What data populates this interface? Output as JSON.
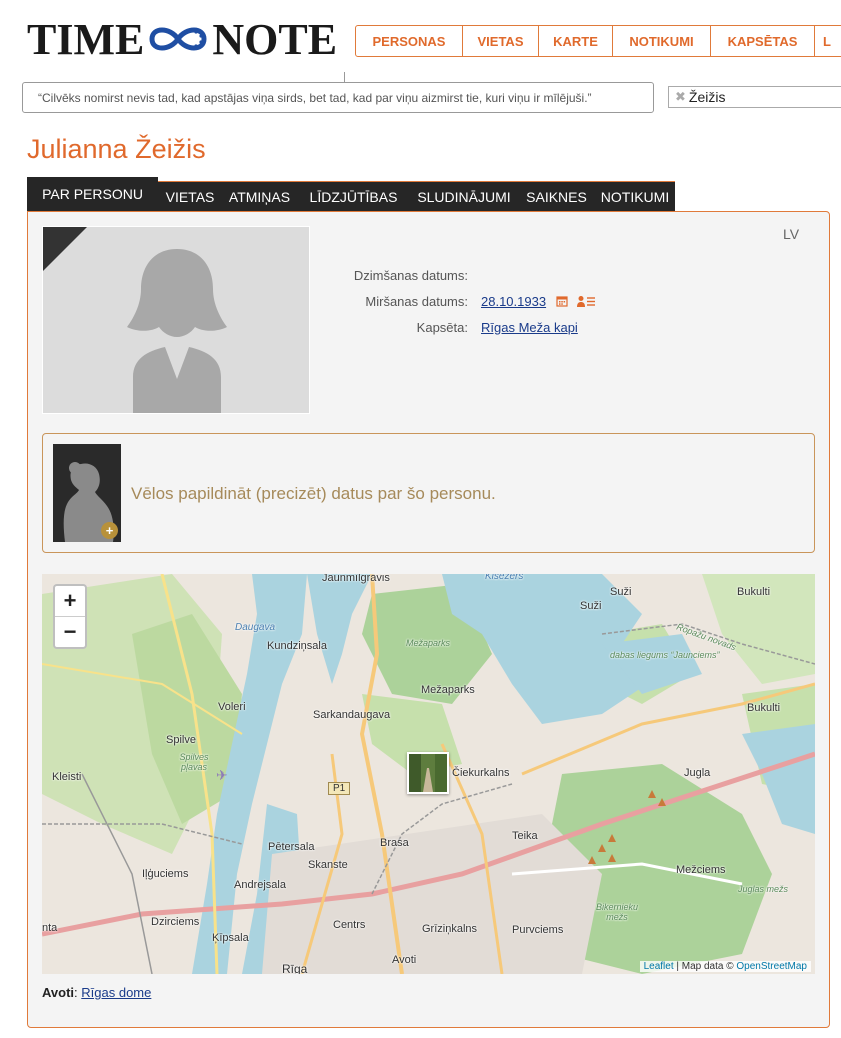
{
  "logo": {
    "left": "TIME",
    "right": "NOTE"
  },
  "topnav": [
    "PERSONAS",
    "VIETAS",
    "KARTE",
    "NOTIKUMI",
    "KAPSĒTAS",
    "L"
  ],
  "quote": "“Cilvēks nomirst nevis tad, kad apstājas viņa sirds, bet tad, kad par viņu aizmirst tie, kuri viņu ir mīlējuši.”",
  "search": {
    "value": "Žeižis"
  },
  "person": {
    "name": "Julianna Žeižis"
  },
  "tabs": [
    "PAR PERSONU",
    "VIETAS",
    "ATMIŅAS",
    "LĪDZJŪTĪBAS",
    "SLUDINĀJUMI",
    "SAIKNES",
    "NOTIKUMI"
  ],
  "lang": "LV",
  "info": {
    "birth_label": "Dzimšanas datums:",
    "birth_value": "",
    "death_label": "Miršanas datums:",
    "death_value": "28.10.1933",
    "cemetery_label": "Kapsēta:",
    "cemetery_value": "Rīgas Meža kapi"
  },
  "suggest": {
    "text": "Vēlos papildināt (precizēt) datus par šo personu.",
    "plus": "+"
  },
  "map": {
    "zoom_in": "+",
    "zoom_out": "−",
    "labels": [
      "Jaunmīlgrāvis",
      "Kīšezers",
      "Suži",
      "Suži",
      "Bukulti",
      "Mežaparks",
      "Kundziņsala",
      "Daugava",
      "Mežaparks",
      "Ropažu novads",
      "dabas liegums “Jaunciems”",
      "Voleri",
      "Sarkandaugava",
      "Bukulti",
      "Spilve",
      "Spilves pļavas",
      "Čiekurkalns",
      "Kleisti",
      "P1",
      "Jugla",
      "Teika",
      "Pētersala",
      "Brasa",
      "Skanste",
      "Iļģuciems",
      "Mežciems",
      "Andrejsala",
      "Juglas mežs",
      "Bikernieku mežs",
      "Dzirciems",
      "Centrs",
      "Grīziņkalns",
      "Purvciems",
      "Ķīpsala",
      "nta",
      "Avoti",
      "Rīga"
    ],
    "attribution_leaflet": "Leaflet",
    "attribution_sep": " | Map data © ",
    "attribution_osm": "OpenStreetMap"
  },
  "source": {
    "label": "Avoti",
    "colon": ": ",
    "link": "Rīgas dome"
  },
  "colors": {
    "accent": "#e0692c",
    "tab_bg": "#262626",
    "link": "#1a3b8a"
  }
}
